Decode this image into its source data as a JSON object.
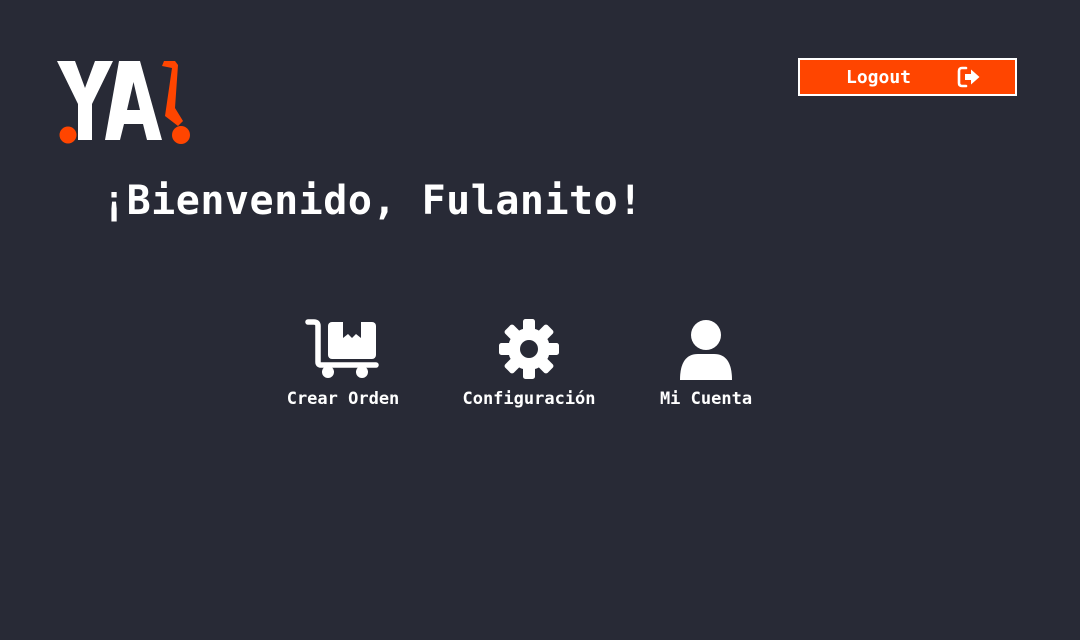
{
  "brand": {
    "logo_text": "YA!",
    "accent_color": "#ff4500",
    "logo_icon": "ya-logo"
  },
  "header": {
    "logout_label": "Logout",
    "logout_icon": "sign-out-icon"
  },
  "main": {
    "welcome": "¡Bienvenido, Fulanito!"
  },
  "menu": {
    "items": [
      {
        "label": "Crear Orden",
        "icon": "dolly-box-icon"
      },
      {
        "label": "Configuración",
        "icon": "gear-icon"
      },
      {
        "label": "Mi Cuenta",
        "icon": "user-icon"
      }
    ]
  },
  "colors": {
    "background": "#282a36",
    "text": "#ffffff",
    "accent": "#ff4500"
  }
}
